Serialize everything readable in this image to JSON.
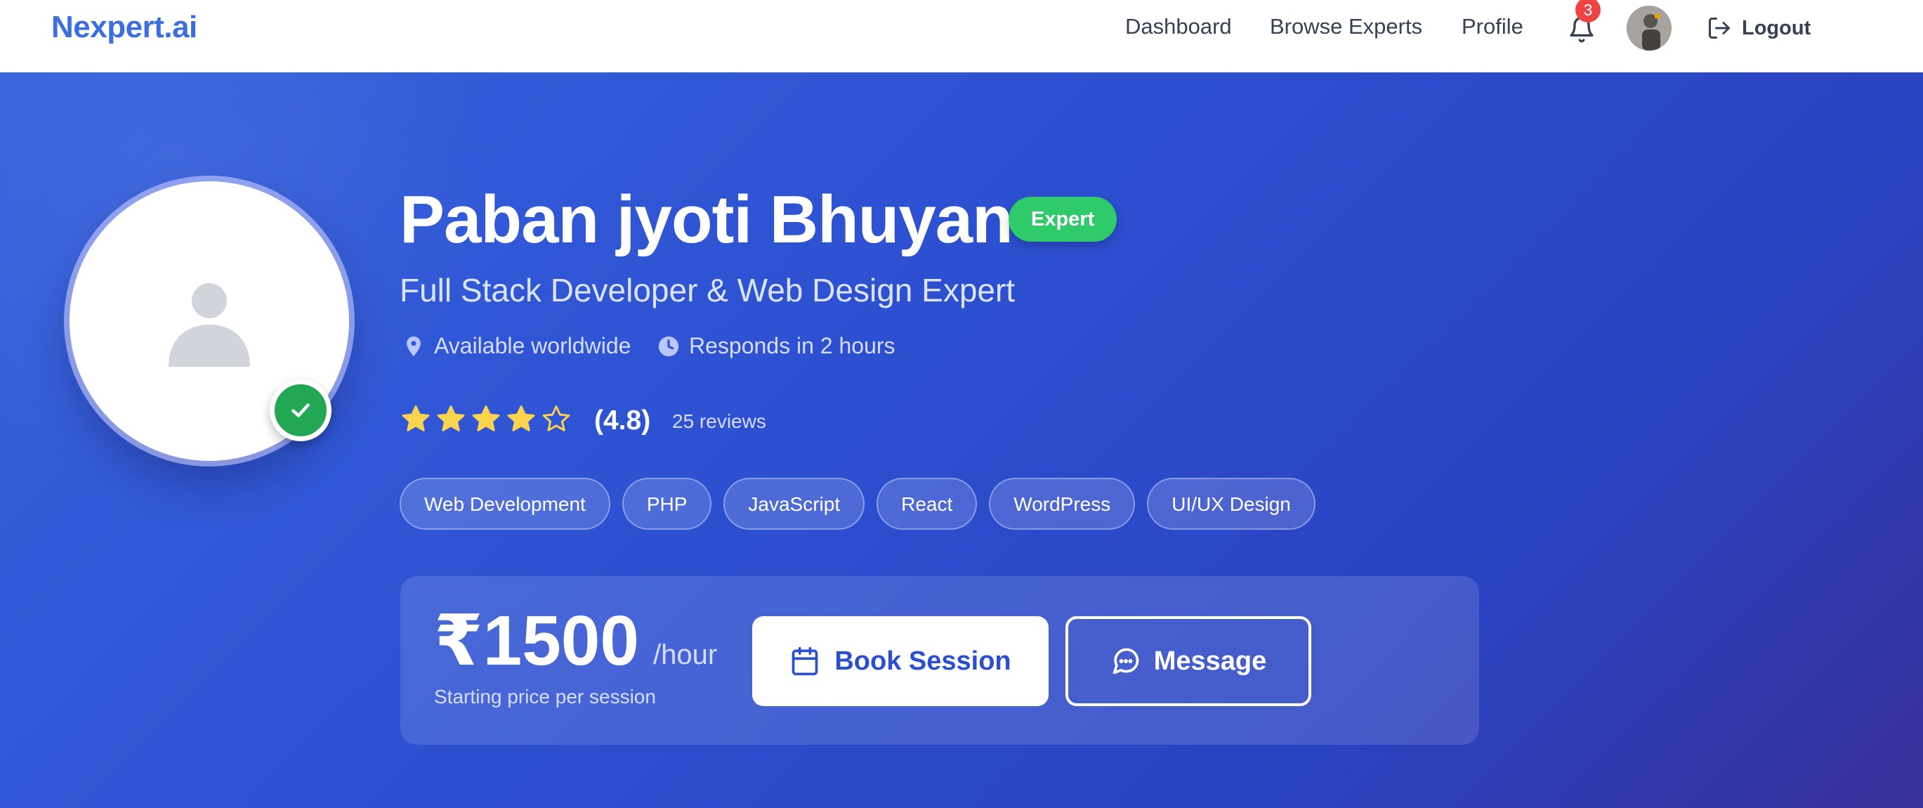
{
  "nav": {
    "logo": "Nexpert.ai",
    "links": [
      "Dashboard",
      "Browse Experts",
      "Profile"
    ],
    "notification_count": "3",
    "notification_icon": "bell-icon",
    "logout_label": "Logout"
  },
  "profile": {
    "name": "Paban jyoti Bhuyan",
    "badge": "Expert",
    "title": "Full Stack Developer & Web Design Expert",
    "location": "Available worldwide",
    "response": "Responds in 2 hours",
    "rating_value": 4.8,
    "rating_text": "(4.8)",
    "stars_filled": 4,
    "stars_total": 5,
    "reviews": "25 reviews",
    "verified": true
  },
  "skills": [
    "Web Development",
    "PHP",
    "JavaScript",
    "React",
    "WordPress",
    "UI/UX Design"
  ],
  "pricing": {
    "price": "₹1500",
    "unit": "/hour",
    "subtitle": "Starting price per session",
    "book_label": "Book Session",
    "message_label": "Message"
  },
  "colors": {
    "brand": "#3b6fe0",
    "hero_start": "#3763de",
    "hero_end": "#37309a",
    "expert_badge": "#2fca6a",
    "verified": "#22a755",
    "star": "#fcd34d",
    "notification_badge": "#ef4444"
  }
}
